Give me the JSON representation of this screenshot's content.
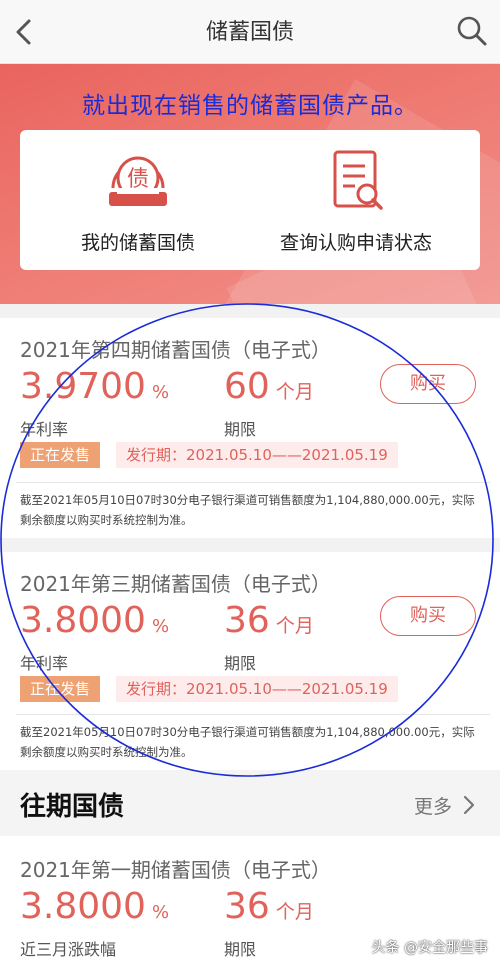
{
  "header": {
    "title": "储蓄国债",
    "back_icon": "chevron-left-icon",
    "search_icon": "search-icon"
  },
  "banner": {
    "text": "就出现在销售的储蓄国债产品。",
    "text_color": "#1a2bd8",
    "entries": [
      {
        "label": "我的储蓄国债",
        "icon": "bond-badge-icon"
      },
      {
        "label": "查询认购申请状态",
        "icon": "document-search-icon"
      }
    ]
  },
  "products": [
    {
      "title": "2021年第四期储蓄国债（电子式）",
      "rate": "3.9700",
      "rate_unit": "%",
      "rate_label": "年利率",
      "term": "60",
      "term_unit": "个月",
      "term_label": "期限",
      "buy_label": "购买",
      "status": "正在发售",
      "issue_period": "发行期：2021.05.10——2021.05.19",
      "note": "截至2021年05月10日07时30分电子银行渠道可销售额度为1,104,880,000.00元，实际剩余额度以购买时系统控制为准。"
    },
    {
      "title": "2021年第三期储蓄国债（电子式）",
      "rate": "3.8000",
      "rate_unit": "%",
      "rate_label": "年利率",
      "term": "36",
      "term_unit": "个月",
      "term_label": "期限",
      "buy_label": "购买",
      "status": "正在发售",
      "issue_period": "发行期：2021.05.10——2021.05.19",
      "note": "截至2021年05月10日07时30分电子银行渠道可销售额度为1,104,880,000.00元，实际剩余额度以购买时系统控制为准。"
    }
  ],
  "past": {
    "title": "往期国债",
    "more_label": "更多",
    "more_icon": "chevron-right-icon",
    "items": [
      {
        "title": "2021年第一期储蓄国债（电子式）",
        "rate": "3.8000",
        "rate_unit": "%",
        "rate_label": "近三月涨跌幅",
        "term": "36",
        "term_unit": "个月",
        "term_label": "期限"
      }
    ]
  },
  "watermark": "头条 @安全那些事",
  "colors": {
    "accent": "#e0625a",
    "status_tag": "#eea273",
    "annotation_circle": "#1a2bd8"
  }
}
